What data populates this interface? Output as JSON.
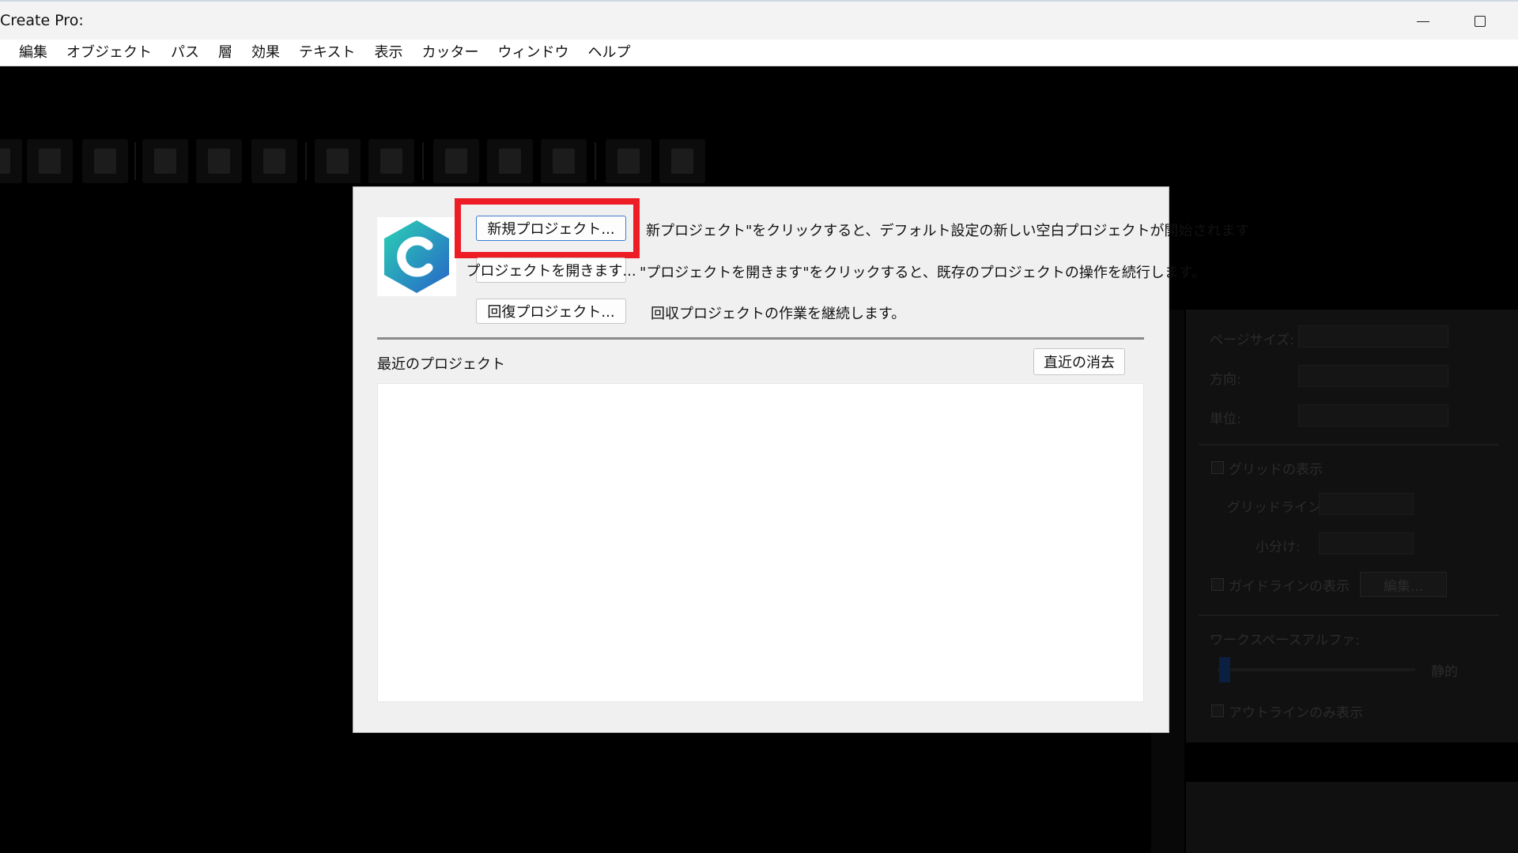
{
  "window": {
    "title": "Create Pro:"
  },
  "menu": {
    "items": [
      "編集",
      "オブジェクト",
      "パス",
      "層",
      "効果",
      "テキスト",
      "表示",
      "カッター",
      "ウィンドウ",
      "ヘルプ"
    ]
  },
  "toolbar": {
    "icons": [
      "new-file-icon",
      "open-icon",
      "save-icon",
      "copy-icon",
      "paste-icon",
      "clipboard-icon",
      "undo-icon",
      "redo-icon",
      "import-image-icon",
      "curve-icon",
      "star-icon",
      "zoom-icon",
      "pen-icon"
    ]
  },
  "dialog": {
    "new_project_label": "新規プロジェクト...",
    "new_project_desc": "新プロジェクト\"をクリックすると、デフォルト設定の新しい空白プロジェクトが開始されます",
    "open_project_label": "プロジェクトを開きます...",
    "open_project_desc": "\"プロジェクトを開きます\"をクリックすると、既存のプロジェクトの操作を続行します。",
    "recover_project_label": "回復プロジェクト...",
    "recover_project_desc": "回収プロジェクトの作業を継続します。",
    "recent_label": "最近のプロジェクト",
    "clear_recent_label": "直近の消去"
  },
  "props": {
    "page_size_label": "ページサイズ:",
    "orientation_label": "方向:",
    "unit_label": "単位:",
    "show_grid_label": "グリッドの表示",
    "grid_line_label": "グリッドライン:",
    "subdivision_label": "小分け:",
    "show_guides_label": "ガイドラインの表示",
    "edit_label": "編集...",
    "workspace_alpha_label": "ワークスペースアルファ:",
    "alpha_value_label": "静的",
    "outline_only_label": "アウトラインのみ表示"
  },
  "colors": {
    "highlight": "#ee1c25",
    "logo_teal": "#1fb5a8",
    "logo_blue": "#2c6fc9"
  }
}
